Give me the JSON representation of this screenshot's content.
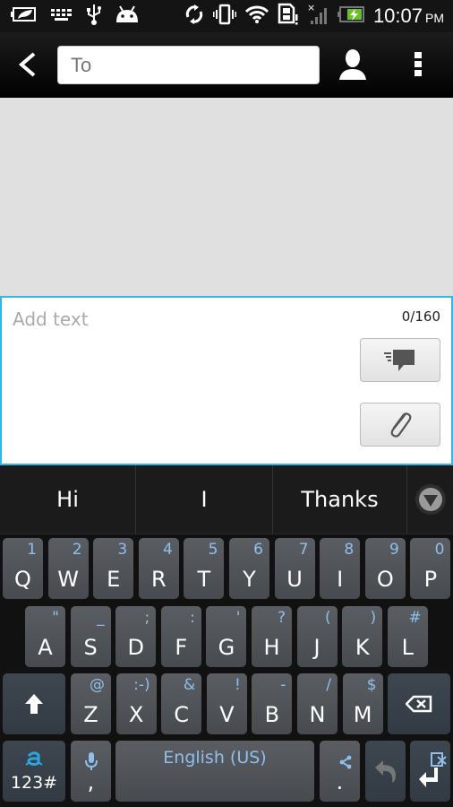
{
  "status_bar": {
    "left_icons": [
      "battery-saver-icon",
      "keyboard-icon",
      "usb-icon",
      "android-icon"
    ],
    "right_icons": [
      "sync-icon",
      "vibrate-icon",
      "wifi-icon",
      "sim-alert-icon",
      "no-signal-icon",
      "battery-charging-icon"
    ],
    "time": "10:07",
    "ampm": "PM"
  },
  "action_bar": {
    "back_icon": "back-chevron-icon",
    "to_placeholder": "To",
    "to_value": "",
    "contact_icon": "person-icon",
    "menu_icon": "overflow-menu-icon"
  },
  "compose": {
    "placeholder": "Add text",
    "value": "",
    "counter": "0/160",
    "send_icon": "send-message-icon",
    "attach_icon": "paperclip-icon",
    "accent_color": "#33b5e5"
  },
  "suggestions": {
    "items": [
      "Hi",
      "I",
      "Thanks"
    ],
    "toggle_icon": "expand-down-icon"
  },
  "keyboard": {
    "row1": [
      {
        "main": "Q",
        "alt": "1"
      },
      {
        "main": "W",
        "alt": "2"
      },
      {
        "main": "E",
        "alt": "3"
      },
      {
        "main": "R",
        "alt": "4"
      },
      {
        "main": "T",
        "alt": "5"
      },
      {
        "main": "Y",
        "alt": "6"
      },
      {
        "main": "U",
        "alt": "7"
      },
      {
        "main": "I",
        "alt": "8"
      },
      {
        "main": "O",
        "alt": "9"
      },
      {
        "main": "P",
        "alt": "0"
      }
    ],
    "row2": [
      {
        "main": "A",
        "alt": "\""
      },
      {
        "main": "S",
        "alt": "_"
      },
      {
        "main": "D",
        "alt": ";"
      },
      {
        "main": "F",
        "alt": ":"
      },
      {
        "main": "G",
        "alt": "'"
      },
      {
        "main": "H",
        "alt": "?"
      },
      {
        "main": "J",
        "alt": "("
      },
      {
        "main": "K",
        "alt": ")"
      },
      {
        "main": "L",
        "alt": "#"
      }
    ],
    "row3": [
      {
        "main": "Z",
        "alt": "@"
      },
      {
        "main": "X",
        "alt": ":-)"
      },
      {
        "main": "C",
        "alt": "&"
      },
      {
        "main": "V",
        "alt": "!"
      },
      {
        "main": "B",
        "alt": "-"
      },
      {
        "main": "N",
        "alt": "/"
      },
      {
        "main": "M",
        "alt": "$"
      }
    ],
    "shift_icon": "shift-arrow-icon",
    "backspace_icon": "backspace-icon",
    "symbols_label": "123#",
    "comma_label": ",",
    "mic_icon": "microphone-icon",
    "space_label": "English (US)",
    "period_label": ".",
    "share_icon": "share-icon",
    "undo_icon": "undo-icon",
    "enter_icon": "enter-icon",
    "alt_color": "#8fbfec"
  }
}
